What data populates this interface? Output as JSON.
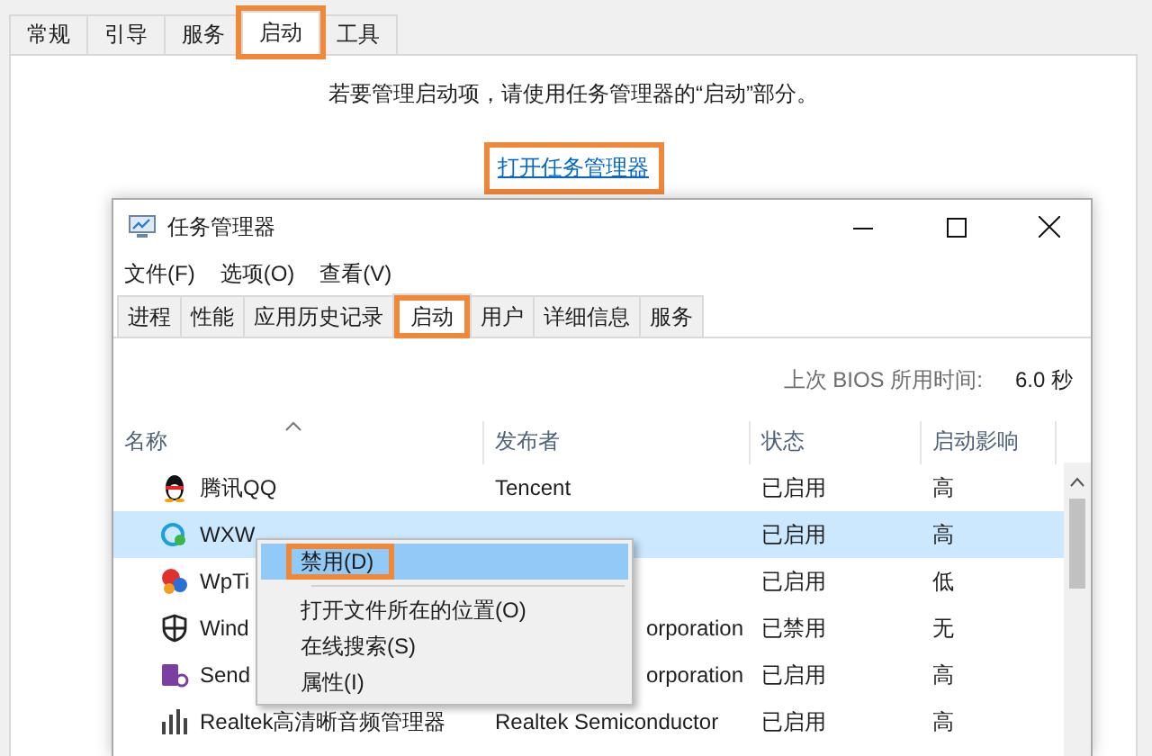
{
  "config_tabs": [
    {
      "label": "常规",
      "selected": false,
      "highlighted": false
    },
    {
      "label": "引导",
      "selected": false,
      "highlighted": false
    },
    {
      "label": "服务",
      "selected": false,
      "highlighted": false
    },
    {
      "label": "启动",
      "selected": true,
      "highlighted": true
    },
    {
      "label": "工具",
      "selected": false,
      "highlighted": false
    }
  ],
  "message": "若要管理启动项，请使用任务管理器的“启动”部分。",
  "link": {
    "label": "打开任务管理器",
    "highlighted": true
  },
  "task_manager": {
    "title": "任务管理器",
    "menu": [
      "文件(F)",
      "选项(O)",
      "查看(V)"
    ],
    "tabs": [
      {
        "label": "进程",
        "selected": false,
        "highlighted": false
      },
      {
        "label": "性能",
        "selected": false,
        "highlighted": false
      },
      {
        "label": "应用历史记录",
        "selected": false,
        "highlighted": false
      },
      {
        "label": "启动",
        "selected": true,
        "highlighted": true
      },
      {
        "label": "用户",
        "selected": false,
        "highlighted": false
      },
      {
        "label": "详细信息",
        "selected": false,
        "highlighted": false
      },
      {
        "label": "服务",
        "selected": false,
        "highlighted": false
      }
    ],
    "bios_label": "上次 BIOS 所用时间:",
    "bios_value": "6.0 秒",
    "columns": [
      "名称",
      "发布者",
      "状态",
      "启动影响"
    ],
    "rows": [
      {
        "kind": "penguin",
        "name": "腾讯QQ",
        "publisher": "Tencent",
        "publisher_clipped": false,
        "status": "已启用",
        "impact": "高",
        "selected": false
      },
      {
        "kind": "chat",
        "name": "WXW",
        "status": "已启用",
        "impact": "高",
        "selected": true
      },
      {
        "kind": "colorful",
        "name": "WpTi",
        "status": "已启用",
        "impact": "低",
        "selected": false
      },
      {
        "kind": "shield",
        "name": "Wind",
        "publisher": "orporation",
        "publisher_clipped": true,
        "status": "已禁用",
        "impact": "无",
        "selected": false
      },
      {
        "kind": "note",
        "name": "Send",
        "publisher": "orporation",
        "publisher_clipped": true,
        "status": "已启用",
        "impact": "高",
        "selected": false
      },
      {
        "kind": "speaker",
        "name": "Realtek高清晰音频管理器",
        "publisher": "Realtek Semiconductor",
        "publisher_clipped": false,
        "status": "已启用",
        "impact": "高",
        "selected": false
      }
    ],
    "context_menu": [
      {
        "label": "禁用(D)",
        "selected": true,
        "highlighted": true
      },
      {
        "label": "打开文件所在的位置(O)",
        "selected": false,
        "highlighted": false
      },
      {
        "label": "在线搜索(S)",
        "selected": false,
        "highlighted": false
      },
      {
        "label": "属性(I)",
        "selected": false,
        "highlighted": false
      }
    ]
  }
}
